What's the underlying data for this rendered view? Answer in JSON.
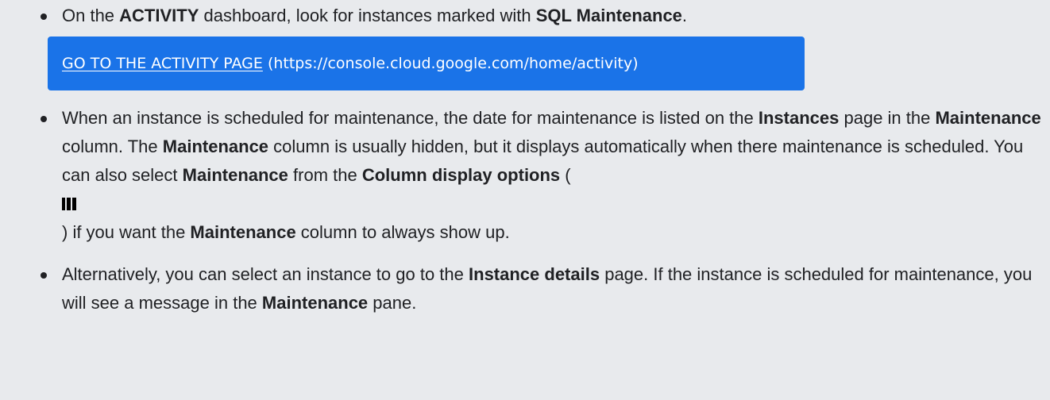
{
  "items": [
    {
      "pre": "On the ",
      "b1": "ACTIVITY",
      "mid": " dashboard, look for instances marked with ",
      "b2": "SQL Maintenance",
      "post": ".",
      "link_label": "GO TO THE ACTIVITY PAGE",
      "link_url": "(https://console.cloud.google.com/home/activity)"
    },
    {
      "t1": "When an instance is scheduled for maintenance, the date for maintenance is listed on the ",
      "b1": "Instances",
      "t2": " page in the ",
      "b2": "Maintenance",
      "t3": " column. The ",
      "b3": "Maintenance",
      "t4": " column is usually hidden, but it displays automatically when there maintenance is scheduled. You can also select ",
      "b4": "Maintenance",
      "t5": " from the ",
      "b5": "Column display options",
      "t6": " (",
      "icon": "column-display-options-icon",
      "t7": ") if you want the ",
      "b6": "Maintenance",
      "t8": " column to always show up."
    },
    {
      "t1": "Alternatively, you can select an instance to go to the ",
      "b1": "Instance details",
      "t2": " page. If the instance is scheduled for maintenance, you will see a message in the ",
      "b2": "Maintenance",
      "t3": " pane."
    }
  ],
  "colors": {
    "page_background": "#e8eaed",
    "text": "#202124",
    "link_box": "#1a73e8",
    "link_text": "#ffffff"
  }
}
